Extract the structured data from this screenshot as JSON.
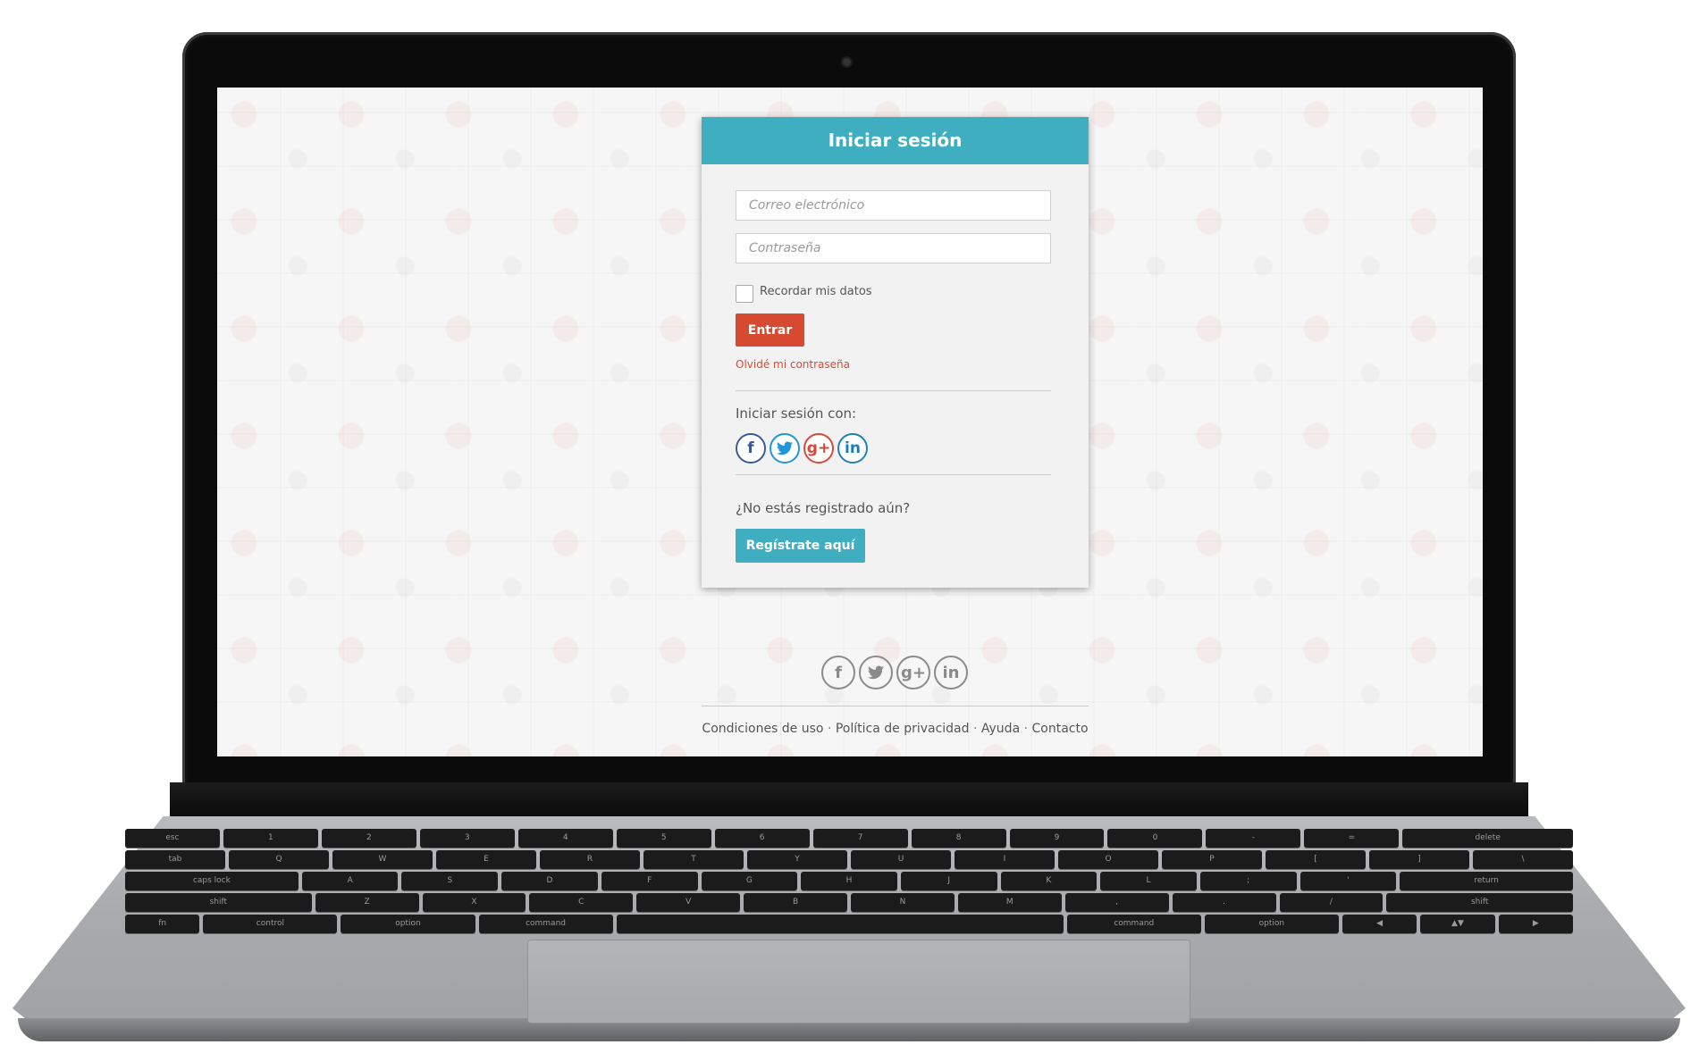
{
  "login": {
    "title": "Iniciar sesión",
    "email_placeholder": "Correo electrónico",
    "password_placeholder": "Contraseña",
    "remember_label": "Recordar mis datos",
    "submit_label": "Entrar",
    "forgot_link": "Olvidé mi contraseña",
    "social_title": "Iniciar sesión con:",
    "register_question": "¿No estás registrado aún?",
    "register_button": "Regístrate aquí"
  },
  "social_icons": {
    "facebook": "f",
    "twitter": "t",
    "google_plus": "g+",
    "linkedin": "in"
  },
  "footer": {
    "links": [
      "Condiciones de uso",
      "Política de privacidad",
      "Ayuda",
      "Contacto"
    ],
    "separator": "·"
  },
  "colors": {
    "header": "#40aec1",
    "submit": "#d74a32",
    "forgot": "#d24e3a",
    "register": "#40aec1"
  },
  "keyboard": {
    "row1": [
      "esc",
      "1",
      "2",
      "3",
      "4",
      "5",
      "6",
      "7",
      "8",
      "9",
      "0",
      "-",
      "=",
      "delete"
    ],
    "row2": [
      "tab",
      "Q",
      "W",
      "E",
      "R",
      "T",
      "Y",
      "U",
      "I",
      "O",
      "P",
      "[",
      "]",
      "\\"
    ],
    "row3": [
      "caps lock",
      "A",
      "S",
      "D",
      "F",
      "G",
      "H",
      "J",
      "K",
      "L",
      ";",
      "'",
      "return"
    ],
    "row4": [
      "shift",
      "Z",
      "X",
      "C",
      "V",
      "B",
      "N",
      "M",
      ",",
      ".",
      "/",
      "shift"
    ],
    "row5": [
      "fn",
      "control",
      "option",
      "command",
      "",
      "command",
      "option",
      "◀",
      "▲▼",
      "▶"
    ]
  }
}
